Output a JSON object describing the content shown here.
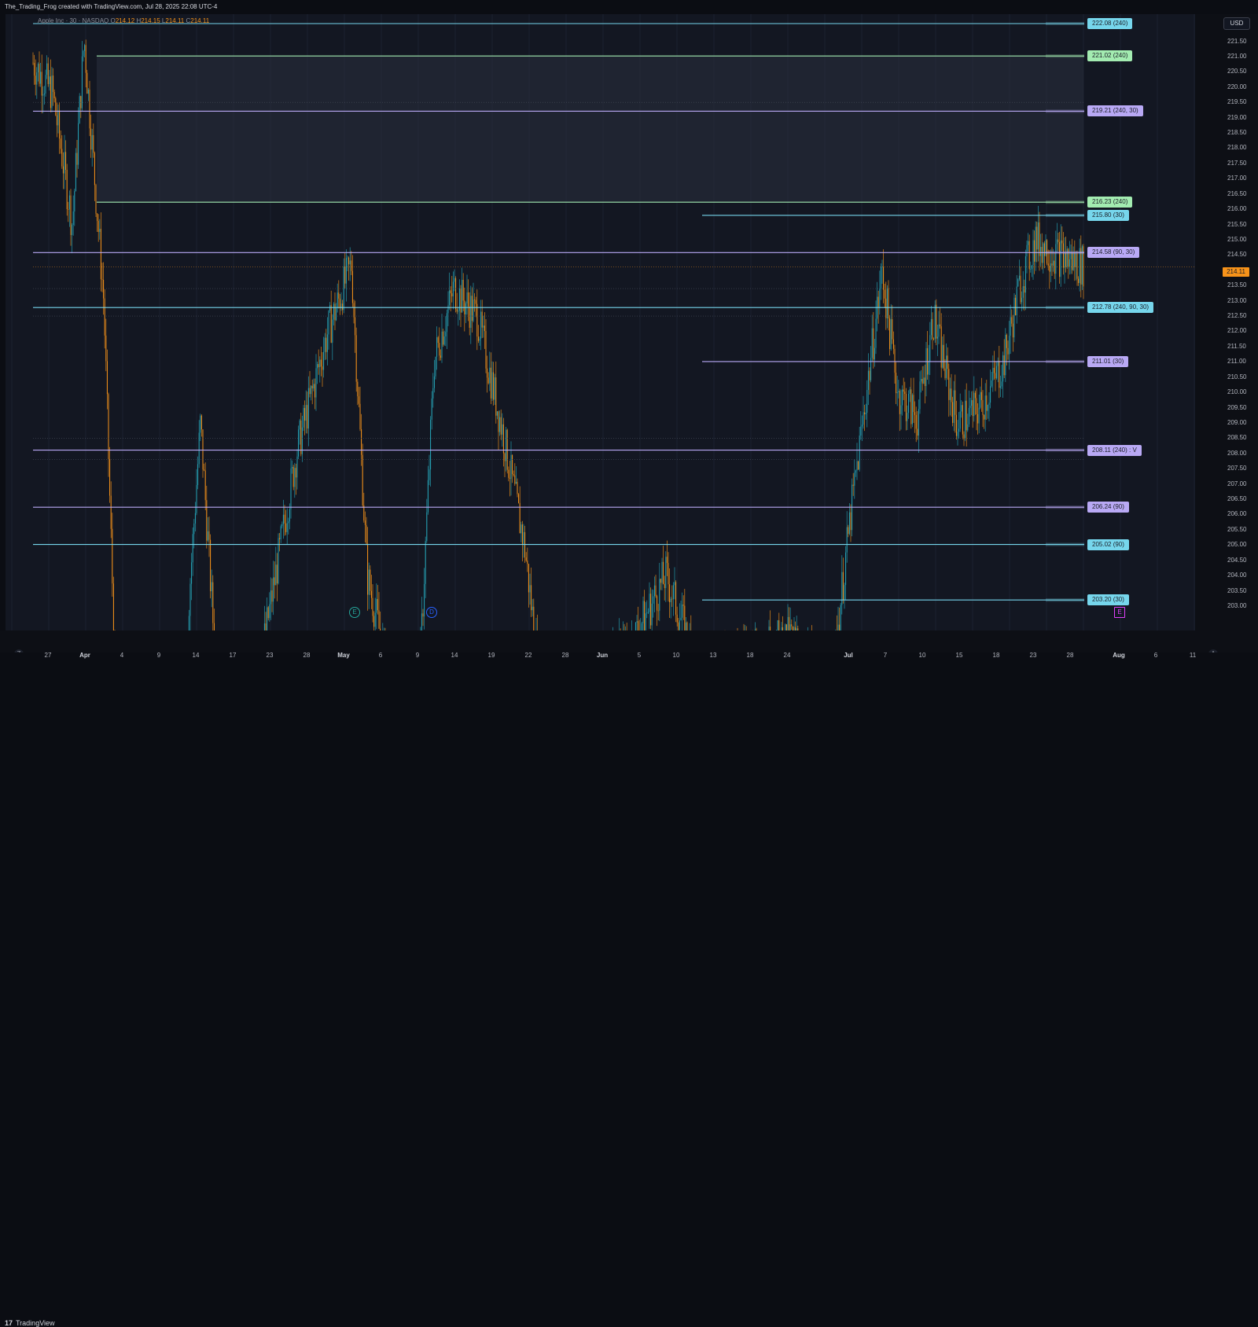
{
  "header": {
    "attribution": "The_Trading_Frog created with TradingView.com, Jul 28, 2025 22:08 UTC-4"
  },
  "legend": {
    "symbol": "Apple Inc · 30 · NASDAQ",
    "open_label": "O",
    "open": "214.12",
    "high_label": "H",
    "high": "214.15",
    "low_label": "L",
    "low": "214.11",
    "close_label": "C",
    "close": "214.11"
  },
  "price_axis": {
    "currency": "USD",
    "ticks": [
      "221.50",
      "221.00",
      "220.50",
      "220.00",
      "219.50",
      "219.00",
      "218.50",
      "218.00",
      "217.50",
      "217.00",
      "216.50",
      "216.00",
      "215.50",
      "215.00",
      "214.50",
      "213.50",
      "213.00",
      "212.50",
      "212.00",
      "211.50",
      "211.00",
      "210.50",
      "210.00",
      "209.50",
      "209.00",
      "208.50",
      "208.00",
      "207.50",
      "207.00",
      "206.50",
      "206.00",
      "205.50",
      "205.00",
      "204.50",
      "204.00",
      "203.50",
      "203.00"
    ],
    "last_price": "214.11",
    "last_price_color": "#f7931a"
  },
  "time_axis": {
    "ticks": [
      {
        "label": "27",
        "bold": false
      },
      {
        "label": "Apr",
        "bold": true
      },
      {
        "label": "4",
        "bold": false
      },
      {
        "label": "9",
        "bold": false
      },
      {
        "label": "14",
        "bold": false
      },
      {
        "label": "17",
        "bold": false
      },
      {
        "label": "23",
        "bold": false
      },
      {
        "label": "28",
        "bold": false
      },
      {
        "label": "May",
        "bold": true
      },
      {
        "label": "6",
        "bold": false
      },
      {
        "label": "9",
        "bold": false
      },
      {
        "label": "14",
        "bold": false
      },
      {
        "label": "19",
        "bold": false
      },
      {
        "label": "22",
        "bold": false
      },
      {
        "label": "28",
        "bold": false
      },
      {
        "label": "Jun",
        "bold": true
      },
      {
        "label": "5",
        "bold": false
      },
      {
        "label": "10",
        "bold": false
      },
      {
        "label": "13",
        "bold": false
      },
      {
        "label": "18",
        "bold": false
      },
      {
        "label": "24",
        "bold": false
      },
      {
        "label": "Jul",
        "bold": true
      },
      {
        "label": "7",
        "bold": false
      },
      {
        "label": "10",
        "bold": false
      },
      {
        "label": "15",
        "bold": false
      },
      {
        "label": "18",
        "bold": false
      },
      {
        "label": "23",
        "bold": false
      },
      {
        "label": "28",
        "bold": false
      },
      {
        "label": "Aug",
        "bold": true
      },
      {
        "label": "6",
        "bold": false
      },
      {
        "label": "11",
        "bold": false
      }
    ]
  },
  "levels": [
    {
      "label": "222.08 (240)",
      "price": 222.08,
      "color": "cyan",
      "start": "full"
    },
    {
      "label": "221.02 (240)",
      "price": 221.02,
      "color": "green",
      "start": "apr"
    },
    {
      "label": "219.21 (240, 30)",
      "price": 219.21,
      "color": "purple",
      "start": "full"
    },
    {
      "label": "216.23 (240)",
      "price": 216.23,
      "color": "green",
      "start": "apr"
    },
    {
      "label": "215.80 (30)",
      "price": 215.8,
      "color": "cyan",
      "start": "jun"
    },
    {
      "label": "214.58 (90, 30)",
      "price": 214.58,
      "color": "purple",
      "start": "full"
    },
    {
      "label": "212.78 (240, 90, 30)",
      "price": 212.78,
      "color": "cyan",
      "start": "full"
    },
    {
      "label": "211.01 (30)",
      "price": 211.01,
      "color": "purple",
      "start": "jun"
    },
    {
      "label": "208.11 (240) : V",
      "price": 208.11,
      "color": "purple",
      "start": "full"
    },
    {
      "label": "206.24 (90)",
      "price": 206.24,
      "color": "purple",
      "start": "full"
    },
    {
      "label": "205.02 (90)",
      "price": 205.02,
      "color": "cyan",
      "start": "full"
    },
    {
      "label": "203.20 (30)",
      "price": 203.2,
      "color": "cyan",
      "start": "jun"
    }
  ],
  "colors": {
    "cyan": "#76d6ec",
    "green": "#a3ecb1",
    "purple": "#b9a9f5",
    "up_candle": "#26a5b8",
    "down_candle": "#f7931a"
  },
  "events": [
    {
      "label": "E",
      "icon": "earnings-icon",
      "color": "#26a69a"
    },
    {
      "label": "D",
      "icon": "dividend-icon",
      "color": "#2962ff"
    },
    {
      "label": "E",
      "icon": "earnings-icon",
      "color": "#e040fb"
    }
  ],
  "footer": {
    "brand": "TradingView",
    "logo_mark": "17"
  },
  "corner_controls": {
    "zoom_left": "Z",
    "auto_right": "A"
  }
}
